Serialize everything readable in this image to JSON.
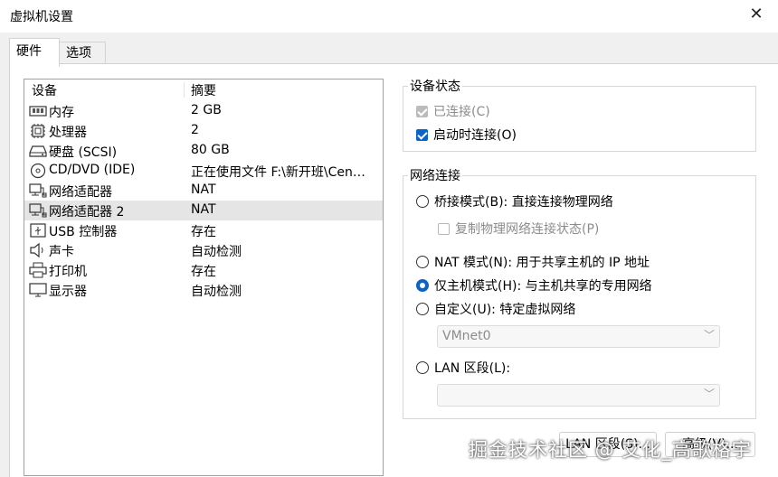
{
  "window": {
    "title": "虚拟机设置"
  },
  "tabs": [
    {
      "label": "硬件",
      "active": true
    },
    {
      "label": "选项",
      "active": false
    }
  ],
  "device_list": {
    "columns": [
      "设备",
      "摘要"
    ],
    "rows": [
      {
        "name": "内存",
        "summary": "2 GB",
        "icon": "memory-icon",
        "selected": false
      },
      {
        "name": "处理器",
        "summary": "2",
        "icon": "processor-icon",
        "selected": false
      },
      {
        "name": "硬盘 (SCSI)",
        "summary": "80 GB",
        "icon": "hard-disk-icon",
        "selected": false
      },
      {
        "name": "CD/DVD (IDE)",
        "summary": "正在使用文件 F:\\新开班\\Cen…",
        "icon": "cd-dvd-icon",
        "selected": false
      },
      {
        "name": "网络适配器",
        "summary": "NAT",
        "icon": "network-adapter-icon",
        "selected": false
      },
      {
        "name": "网络适配器 2",
        "summary": "NAT",
        "icon": "network-adapter-icon",
        "selected": true
      },
      {
        "name": "USB 控制器",
        "summary": "存在",
        "icon": "usb-icon",
        "selected": false
      },
      {
        "name": "声卡",
        "summary": "自动检测",
        "icon": "speaker-icon",
        "selected": false
      },
      {
        "name": "打印机",
        "summary": "存在",
        "icon": "printer-icon",
        "selected": false
      },
      {
        "name": "显示器",
        "summary": "自动检测",
        "icon": "monitor-icon",
        "selected": false
      }
    ]
  },
  "device_status": {
    "title": "设备状态",
    "connected": {
      "label": "已连接(C)",
      "checked": true,
      "enabled": false
    },
    "connect_at_power_on": {
      "label": "启动时连接(O)",
      "checked": true,
      "enabled": true
    }
  },
  "network_connection": {
    "title": "网络连接",
    "bridged": {
      "label": "桥接模式(B): 直接连接物理网络",
      "selected": false
    },
    "replicate": {
      "label": "复制物理网络连接状态(P)",
      "checked": false,
      "enabled": false
    },
    "nat": {
      "label": "NAT 模式(N): 用于共享主机的 IP 地址",
      "selected": false
    },
    "host_only": {
      "label": "仅主机模式(H): 与主机共享的专用网络",
      "selected": true
    },
    "custom": {
      "label": "自定义(U): 特定虚拟网络",
      "selected": false
    },
    "custom_network_value": "VMnet0",
    "lan_segment": {
      "label": "LAN 区段(L):",
      "selected": false
    },
    "lan_segment_value": ""
  },
  "buttons": {
    "lan_segments": "LAN 区段(S)...",
    "advanced": "高级(V)..."
  },
  "watermark": "掘金技术社区 @ 艾化_高歌格宇"
}
